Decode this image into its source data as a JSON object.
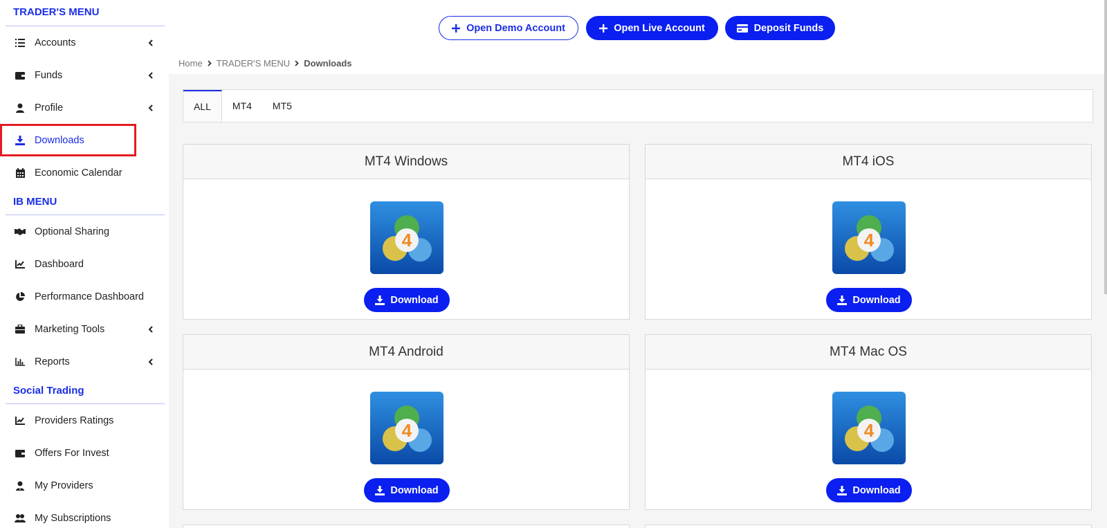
{
  "sidebar": {
    "sections": [
      {
        "title": "TRADER'S MENU",
        "items": [
          {
            "label": "Accounts",
            "icon": "list-icon",
            "chevron": true
          },
          {
            "label": "Funds",
            "icon": "wallet-icon",
            "chevron": true
          },
          {
            "label": "Profile",
            "icon": "user-icon",
            "chevron": true
          },
          {
            "label": "Downloads",
            "icon": "download-icon",
            "chevron": false,
            "active": true
          },
          {
            "label": "Economic Calendar",
            "icon": "calendar-icon",
            "chevron": false
          }
        ]
      },
      {
        "title": "IB MENU",
        "items": [
          {
            "label": "Optional Sharing",
            "icon": "handshake-icon",
            "chevron": false
          },
          {
            "label": "Dashboard",
            "icon": "line-chart-icon",
            "chevron": false
          },
          {
            "label": "Performance Dashboard",
            "icon": "pie-chart-icon",
            "chevron": false
          },
          {
            "label": "Marketing Tools",
            "icon": "briefcase-icon",
            "chevron": true
          },
          {
            "label": "Reports",
            "icon": "bar-chart-icon",
            "chevron": true
          }
        ]
      },
      {
        "title": "Social Trading",
        "items": [
          {
            "label": "Providers Ratings",
            "icon": "line-chart-icon",
            "chevron": false
          },
          {
            "label": "Offers For Invest",
            "icon": "wallet-icon",
            "chevron": false
          },
          {
            "label": "My Providers",
            "icon": "user-tie-icon",
            "chevron": false
          },
          {
            "label": "My Subscriptions",
            "icon": "users-icon",
            "chevron": false
          }
        ]
      }
    ]
  },
  "header": {
    "open_demo": "Open Demo Account",
    "open_live": "Open Live Account",
    "deposit": "Deposit Funds"
  },
  "breadcrumb": {
    "home": "Home",
    "section": "TRADER'S MENU",
    "current": "Downloads"
  },
  "tabs": [
    "ALL",
    "MT4",
    "MT5"
  ],
  "cards": [
    {
      "title": "MT4 Windows",
      "button": "Download"
    },
    {
      "title": "MT4 iOS",
      "button": "Download"
    },
    {
      "title": "MT4 Android",
      "button": "Download"
    },
    {
      "title": "MT4 Mac OS",
      "button": "Download"
    }
  ],
  "colors": {
    "accent": "#0a1ff0",
    "highlight": "#e31b23"
  }
}
